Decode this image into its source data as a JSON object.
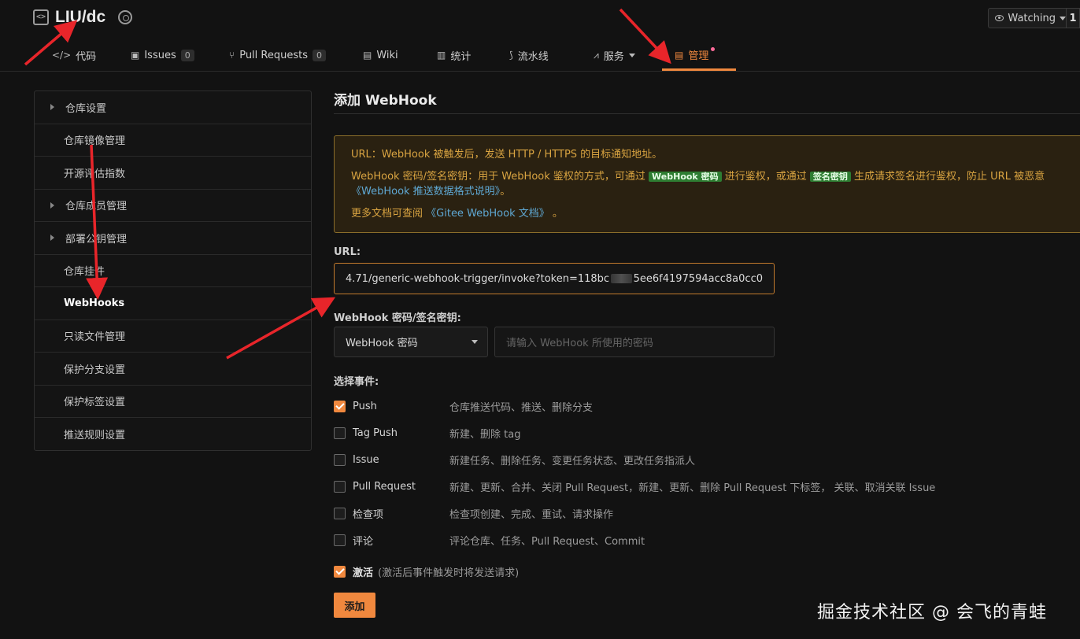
{
  "header": {
    "repo_name": "LIU/dc",
    "watch_label": "Watching",
    "watch_count": "1"
  },
  "tabs": [
    {
      "label": "代码",
      "icon": "code-icon"
    },
    {
      "label": "Issues",
      "count": "0",
      "icon": "issues-icon"
    },
    {
      "label": "Pull Requests",
      "count": "0",
      "icon": "pull-request-icon"
    },
    {
      "label": "Wiki",
      "icon": "wiki-icon"
    },
    {
      "label": "统计",
      "icon": "stats-icon"
    },
    {
      "label": "流水线",
      "icon": "pipeline-icon"
    },
    {
      "label": "服务",
      "icon": "service-icon"
    },
    {
      "label": "管理",
      "icon": "manage-icon"
    }
  ],
  "sidebar": {
    "items": [
      {
        "label": "仓库设置"
      },
      {
        "label": "仓库镜像管理"
      },
      {
        "label": "开源评估指数"
      },
      {
        "label": "仓库成员管理"
      },
      {
        "label": "部署公钥管理"
      },
      {
        "label": "仓库挂件"
      },
      {
        "label": "WebHooks"
      },
      {
        "label": "只读文件管理"
      },
      {
        "label": "保护分支设置"
      },
      {
        "label": "保护标签设置"
      },
      {
        "label": "推送规则设置"
      }
    ]
  },
  "main": {
    "title": "添加 WebHook",
    "notice": {
      "line1": "URL：WebHook 被触发后，发送 HTTP / HTTPS 的目标通知地址。",
      "line2_a": "WebHook 密码/签名密钥：用于 WebHook 鉴权的方式，可通过",
      "tag1": "WebHook 密码",
      "line2_b": "进行鉴权，或通过",
      "tag2": "签名密钥",
      "line2_c": "生成请求签名进行鉴权，防止 URL 被恶意",
      "line3_link": "《WebHook 推送数据格式说明》",
      "line3_end": "。",
      "line4_a": "更多文档可查阅",
      "line4_link": "《Gitee WebHook 文档》",
      "line4_end": "。"
    },
    "url_label": "URL:",
    "url_value_a": "4.71/generic-webhook-trigger/invoke?token=118bc",
    "url_value_b": "5ee6f4197594acc8a0cc0",
    "secret_label": "WebHook 密码/签名密钥:",
    "secret_type": "WebHook 密码",
    "secret_placeholder": "请输入 WebHook 所使用的密码",
    "events_label": "选择事件:",
    "events": [
      {
        "name": "Push",
        "desc": "仓库推送代码、推送、删除分支"
      },
      {
        "name": "Tag Push",
        "desc": "新建、删除 tag"
      },
      {
        "name": "Issue",
        "desc": "新建任务、删除任务、变更任务状态、更改任务指派人"
      },
      {
        "name": "Pull Request",
        "desc": "新建、更新、合并、关闭 Pull Request，新建、更新、删除 Pull Request 下标签， 关联、取消关联 Issue"
      },
      {
        "name": "检查项",
        "desc": "检查项创建、完成、重试、请求操作"
      },
      {
        "name": "评论",
        "desc": "评论仓库、任务、Pull Request、Commit"
      }
    ],
    "activate_label": "激活",
    "activate_hint": "(激活后事件触发时将发送请求)",
    "add_button": "添加"
  },
  "watermark": "掘金技术社区 @ 会飞的青蛙",
  "colors": {
    "accent": "#f0883e",
    "annotation": "#e8252a"
  }
}
